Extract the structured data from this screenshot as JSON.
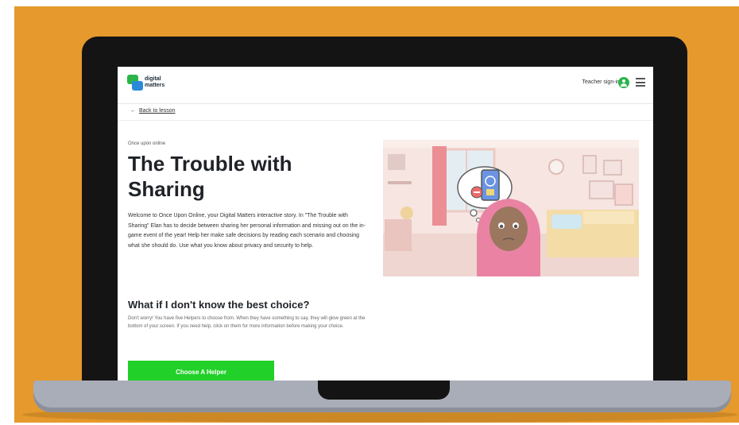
{
  "site": {
    "logo_line1": "digital",
    "logo_line2": "matters",
    "teacher_link": "Teacher sign-in"
  },
  "nav": {
    "back_label": "Back to lesson",
    "back_arrow": "←"
  },
  "story": {
    "kicker": "Once upon online",
    "title": "The Trouble with Sharing",
    "intro": "Welcome to Once Upon Online, your Digital Matters interactive story. In \"The Trouble with Sharing\" Elan has to decide between sharing her personal information and missing out on the in-game event of the year! Help her make safe decisions by reading each scenario and choosing what she should do. Use what you know about privacy and security to help.",
    "help_heading": "What if I don't know the best choice?",
    "help_text": "Don't worry! You have five Helpers to choose from. When they have something to say, they will glow green at the bottom of your screen. If you need help, click on them for more information before making your choice.",
    "cta_label": "Choose A Helper"
  },
  "colors": {
    "background": "#e6992c",
    "accent_green": "#22d02a",
    "text_dark": "#1f2328"
  },
  "icons": {
    "user": "user-circle-icon",
    "menu": "hamburger-menu-icon",
    "back": "arrow-left-icon"
  }
}
